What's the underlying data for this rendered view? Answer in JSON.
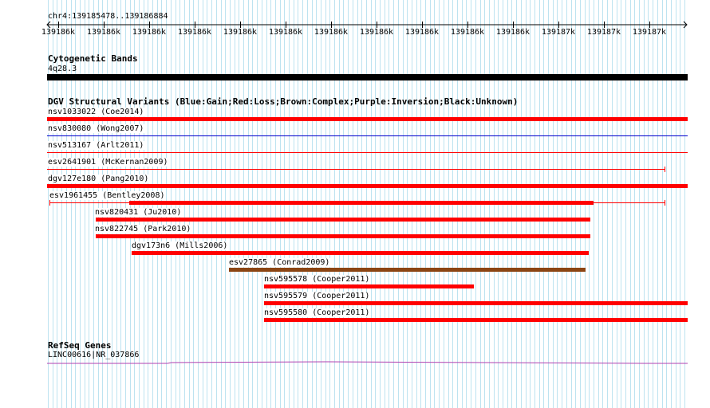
{
  "ruler": {
    "location": "chr4:139185478..139186884",
    "ticks": [
      "139186k",
      "139186k",
      "139186k",
      "139186k",
      "139186k",
      "139186k",
      "139186k",
      "139186k",
      "139186k",
      "139186k",
      "139186k",
      "139187k",
      "139187k",
      "139187k"
    ]
  },
  "cytoband": {
    "title": "Cytogenetic Bands",
    "band": "4q28.3"
  },
  "dgv": {
    "title": "DGV Structural Variants (Blue:Gain;Red:Loss;Brown:Complex;Purple:Inversion;Black:Unknown)",
    "colors": {
      "gain": "#0000cc",
      "loss": "#ff0000",
      "complex": "#8b4513",
      "inversion": "#800080",
      "unknown": "#000000"
    },
    "variants": [
      {
        "label": "nsv1033022 (Coe2014)",
        "type": "loss"
      },
      {
        "label": "nsv830080 (Wong2007)",
        "type": "gain"
      },
      {
        "label": "nsv513167 (Arlt2011)",
        "type": "loss"
      },
      {
        "label": "esv2641901 (McKernan2009)",
        "type": "loss"
      },
      {
        "label": "dgv127e180 (Pang2010)",
        "type": "loss"
      },
      {
        "label": "esv1961455 (Bentley2008)",
        "type": "loss"
      },
      {
        "label": "nsv820431 (Ju2010)",
        "type": "loss"
      },
      {
        "label": "nsv822745 (Park2010)",
        "type": "loss"
      },
      {
        "label": "dgv173n6 (Mills2006)",
        "type": "loss"
      },
      {
        "label": "esv27865 (Conrad2009)",
        "type": "complex"
      },
      {
        "label": "nsv595578 (Cooper2011)",
        "type": "loss"
      },
      {
        "label": "nsv595579 (Cooper2011)",
        "type": "loss"
      },
      {
        "label": "nsv595580 (Cooper2011)",
        "type": "loss"
      }
    ]
  },
  "refseq": {
    "title": "RefSeq Genes",
    "gene": "LINC00616|NR_037866",
    "color": "#b040b0"
  }
}
